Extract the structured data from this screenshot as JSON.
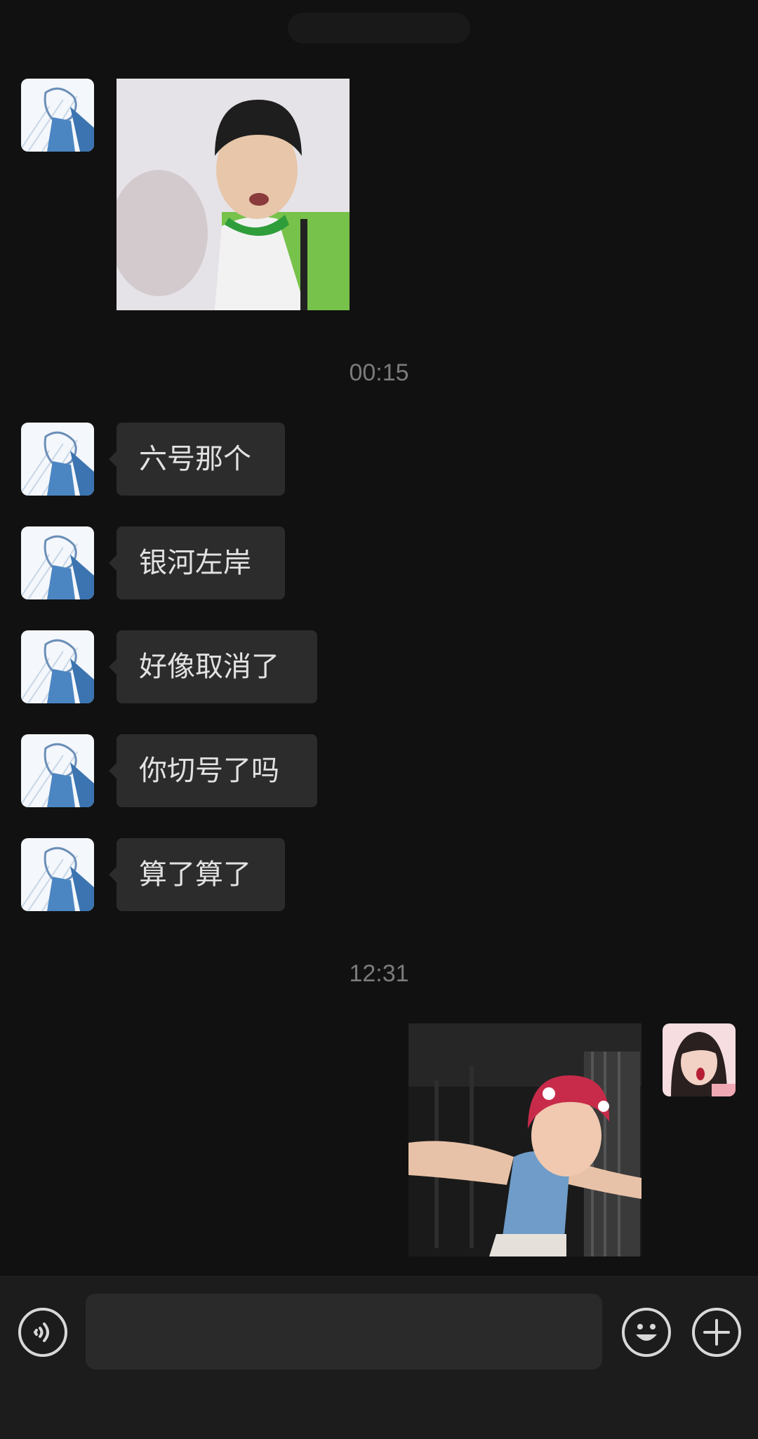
{
  "chat": {
    "header_title": "",
    "timestamps": [
      "00:15",
      "12:31"
    ],
    "messages": [
      {
        "text": "六号那个"
      },
      {
        "text": "银河左岸"
      },
      {
        "text": "好像取消了"
      },
      {
        "text": "你切号了吗"
      },
      {
        "text": "算了算了"
      }
    ],
    "incoming_image": "meme-photo-boy-green-shirt",
    "outgoing_image": "photo-dancing-woman-red-hair"
  },
  "input_bar": {
    "voice_icon": "voice-icon",
    "emoji_icon": "emoji-icon",
    "more_icon": "plus-icon",
    "input_value": ""
  },
  "colors": {
    "background": "#111111",
    "bubble": "#2c2c2c",
    "bubble_text": "#e2e2e2",
    "timestamp": "#7b7b7b",
    "bar": "#1c1c1c"
  }
}
